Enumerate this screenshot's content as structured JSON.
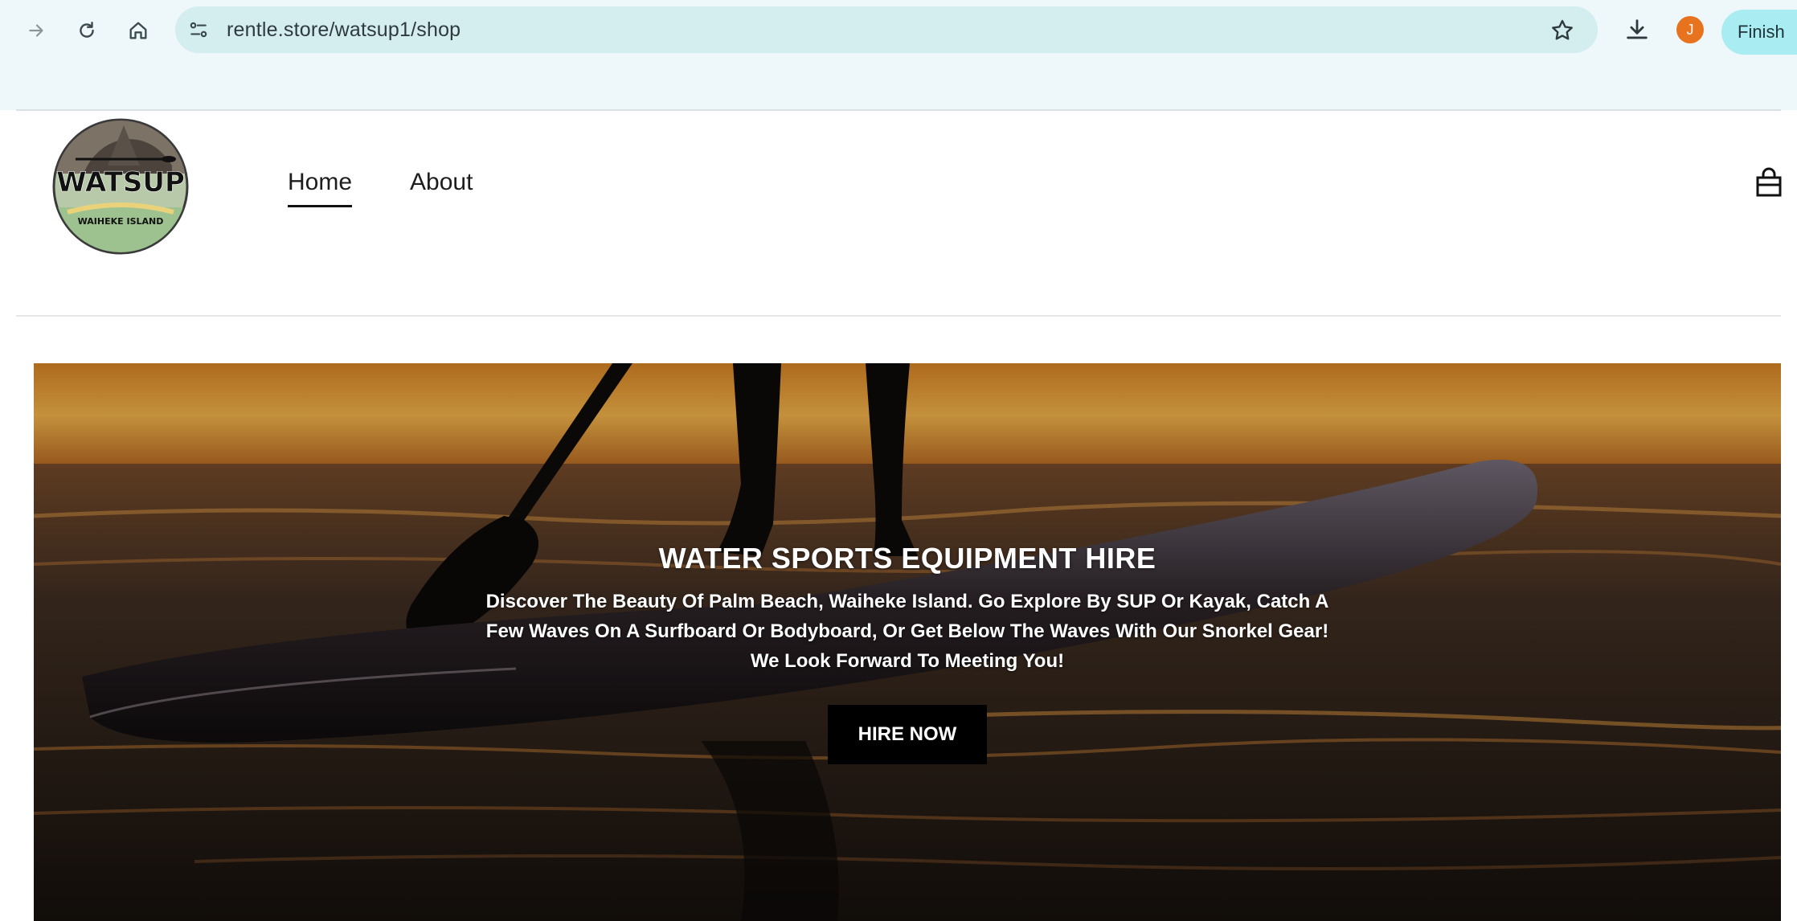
{
  "browser": {
    "url": "rentle.store/watsup1/shop",
    "profile_initial": "J",
    "finish_label": "Finish",
    "icons": [
      "forward-icon",
      "reload-icon",
      "home-icon",
      "site-info-icon",
      "star-icon",
      "download-icon"
    ]
  },
  "header": {
    "logo": {
      "title": "WATSUP",
      "subtitle": "WAIHEKE ISLAND"
    },
    "nav": {
      "home": "Home",
      "about": "About"
    },
    "active_nav": "Home",
    "cart_icon": "shopping-bag-icon"
  },
  "hero": {
    "title": "WATER SPORTS EQUIPMENT HIRE",
    "description": "Discover The Beauty Of Palm Beach, Waiheke Island. Go Explore By SUP Or Kayak, Catch A Few Waves On A Surfboard Or Bodyboard, Or Get Below The Waves With Our Snorkel Gear! We Look Forward To Meeting You!",
    "button": "HIRE NOW"
  },
  "colors": {
    "omnibox": "#d4edef",
    "finish_button": "#a9ecf2",
    "avatar": "#e8731e",
    "hero_button": "#000000"
  }
}
